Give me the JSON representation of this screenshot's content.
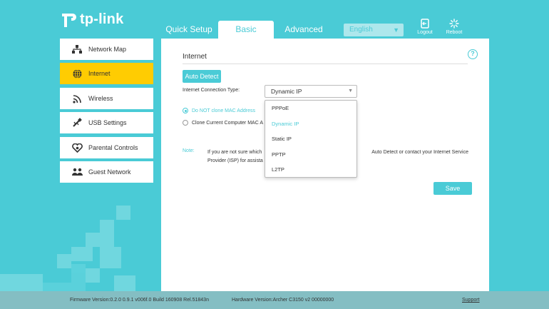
{
  "brand": {
    "name": "tp-link",
    "accent": "#4acbd6",
    "active_nav": "#ffcc02"
  },
  "header": {
    "tabs": [
      "Quick Setup",
      "Basic",
      "Advanced"
    ],
    "active_tab": "Basic",
    "language": "English",
    "logout_label": "Logout",
    "reboot_label": "Reboot"
  },
  "sidebar": {
    "items": [
      {
        "label": "Network Map",
        "icon": "network-map-icon"
      },
      {
        "label": "Internet",
        "icon": "globe-icon",
        "active": true
      },
      {
        "label": "Wireless",
        "icon": "wireless-icon"
      },
      {
        "label": "USB Settings",
        "icon": "usb-icon"
      },
      {
        "label": "Parental Controls",
        "icon": "parental-controls-icon"
      },
      {
        "label": "Guest Network",
        "icon": "guest-network-icon"
      }
    ]
  },
  "main": {
    "section_title": "Internet",
    "auto_detect_label": "Auto Detect",
    "connection_type_label": "Internet Connection Type:",
    "connection_type_value": "Dynamic IP",
    "connection_type_options": [
      "PPPoE",
      "Dynamic IP",
      "Static IP",
      "PPTP",
      "L2TP"
    ],
    "mac_options": [
      {
        "label": "Do NOT clone MAC Address",
        "selected": true
      },
      {
        "label": "Clone Current Computer MAC A",
        "selected": false
      }
    ],
    "note_label": "Note:",
    "note_text_1": "If you are not sure which",
    "note_text_2": "Auto Detect or contact your Internet Service",
    "note_text_3": "Provider (ISP) for assista",
    "save_label": "Save"
  },
  "footer": {
    "firmware": "Firmware Version:0.2.0 0.9.1 v006f.0 Build 160908 Rel.51843n",
    "hardware": "Hardware Version:Archer C3150 v2 00000000",
    "support": "Support"
  }
}
